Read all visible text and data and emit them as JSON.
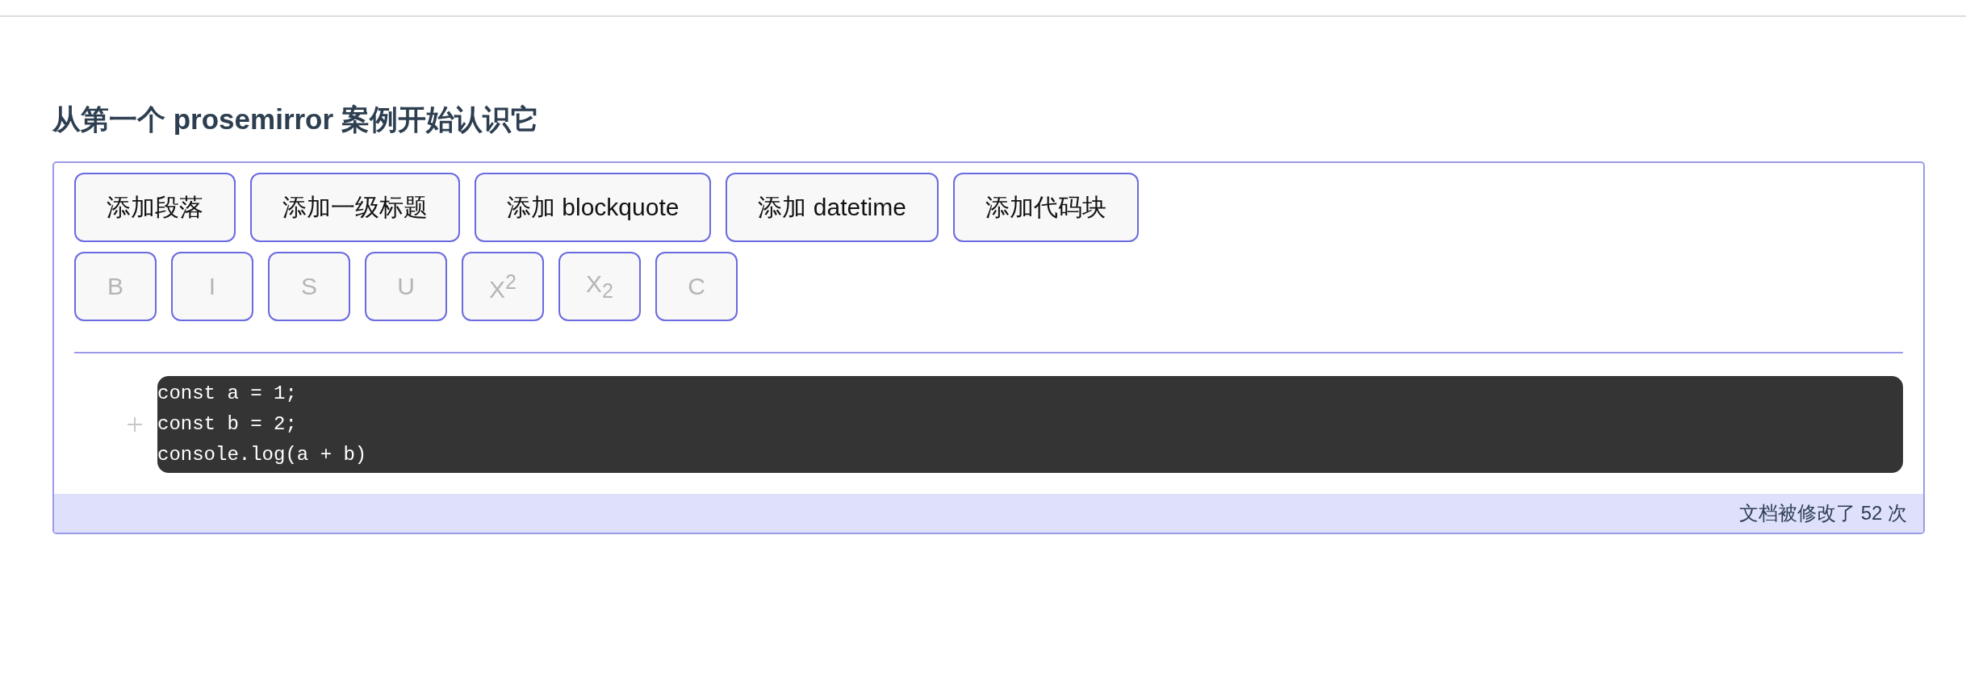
{
  "heading": "从第一个 prosemirror 案例开始认识它",
  "insert_buttons": [
    {
      "label": "添加段落"
    },
    {
      "label": "添加一级标题"
    },
    {
      "label": "添加 blockquote"
    },
    {
      "label": "添加 datetime"
    },
    {
      "label": "添加代码块"
    }
  ],
  "mark_buttons": [
    {
      "label": "B",
      "disabled": true
    },
    {
      "label": "I",
      "disabled": true
    },
    {
      "label": "S",
      "disabled": true
    },
    {
      "label": "U",
      "disabled": true
    },
    {
      "label": "X$^{2}$",
      "disabled": true
    },
    {
      "label": "X$_{2}$",
      "disabled": true
    },
    {
      "label": "C",
      "disabled": true
    }
  ],
  "code_block": {
    "lines": [
      "const a = 1;",
      "const b = 2;",
      "console.log(a + b)"
    ]
  },
  "status_bar": {
    "text": "文档被修改了 52 次"
  }
}
